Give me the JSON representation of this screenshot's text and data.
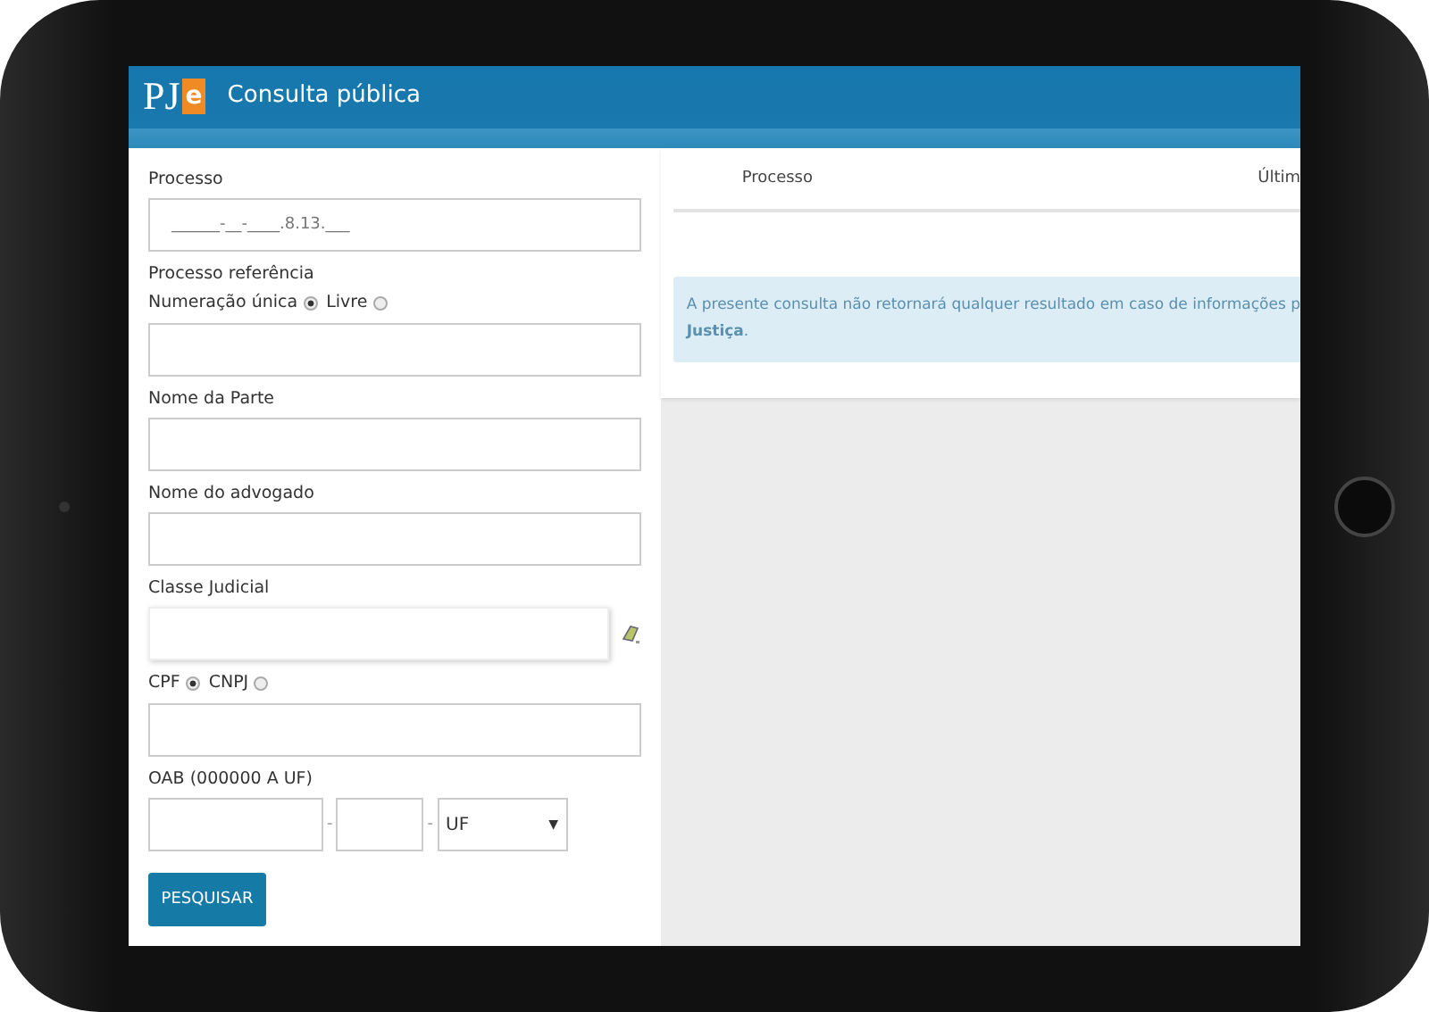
{
  "header": {
    "logo": {
      "letters": "PJ",
      "accent": "e"
    },
    "title": "Consulta pública"
  },
  "form": {
    "process": {
      "label": "Processo",
      "placeholder": "______-__-____.8.13.___"
    },
    "reference": {
      "label": "Processo referência",
      "options": [
        {
          "label": "Numeração única",
          "selected": true
        },
        {
          "label": "Livre",
          "selected": false
        }
      ]
    },
    "fields": [
      {
        "label": "Nome da Parte"
      },
      {
        "label": "Nome do advogado"
      }
    ],
    "class": {
      "label": "Classe Judicial"
    },
    "document": {
      "options": [
        {
          "label": "CPF",
          "selected": true
        },
        {
          "label": "CNPJ",
          "selected": false
        }
      ]
    },
    "oab": {
      "label": "OAB (000000 A UF)",
      "separators": [
        "-",
        "-"
      ],
      "state": "UF",
      "caret": "▼"
    },
    "button": "PESQUISAR"
  },
  "results": {
    "columns": [
      "Processo",
      "Últim"
    ],
    "notice": [
      "A presente consulta não retornará qualquer resultado em caso de informações p",
      "**Justiça**."
    ]
  }
}
